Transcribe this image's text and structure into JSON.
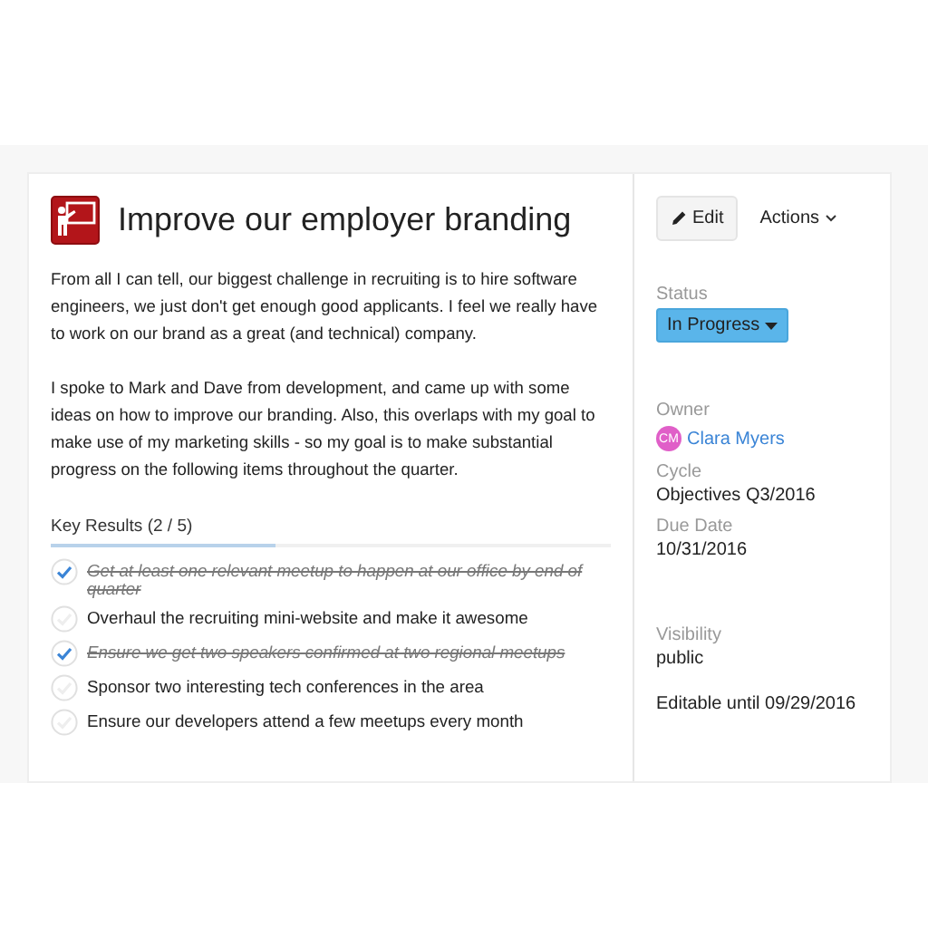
{
  "objective": {
    "title": "Improve our employer branding",
    "paragraphs": [
      "From all I can tell, our biggest challenge in recruiting is to hire software engineers, we just don't get enough good applicants. I feel we really have to work on our brand as a great (and technical) company.",
      "I spoke to Mark and Dave from development, and came up with some ideas on how to improve our branding. Also, this overlaps with my goal to make use of my marketing skills - so my goal is to make substantial progress on the following items throughout the quarter."
    ]
  },
  "key_results": {
    "heading": "Key Results (2 / 5)",
    "level": 0.4,
    "items": [
      {
        "text": "Get at least one relevant meetup to happen at our office by end of quarter",
        "checked": true
      },
      {
        "text": "Overhaul the recruiting mini-website and make it awesome",
        "checked": false
      },
      {
        "text": "Ensure we get two speakers confirmed at two regional meetups",
        "checked": true
      },
      {
        "text": "Sponsor two interesting tech conferences in the area",
        "checked": false
      },
      {
        "text": "Ensure our developers attend a few meetups every month",
        "checked": false
      }
    ]
  },
  "sidebar": {
    "edit_button": "Edit",
    "actions_button": "Actions",
    "status": {
      "label": "Status",
      "value": "In Progress"
    },
    "owner": {
      "label": "Owner",
      "initials": "CM",
      "name": "Clara Myers",
      "color": "#e05fc8"
    },
    "cycle": {
      "label": "Cycle",
      "value": "Objectives Q3/2016"
    },
    "due_date": {
      "label": "Due Date",
      "value": "10/31/2016"
    },
    "visibility": {
      "label": "Visibility",
      "value": "public"
    },
    "editable_until": "Editable until 09/29/2016"
  }
}
